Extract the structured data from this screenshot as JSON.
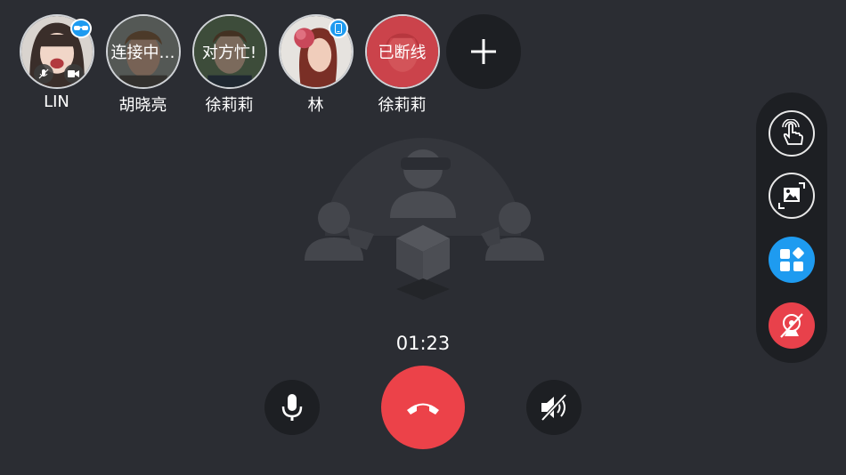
{
  "participants": [
    {
      "name": "LIN",
      "status": "",
      "badge": "glasses-icon"
    },
    {
      "name": "胡晓亮",
      "status": "连接中…",
      "badge": ""
    },
    {
      "name": "徐莉莉",
      "status": "对方忙!",
      "badge": ""
    },
    {
      "name": "林",
      "status": "",
      "badge": "phone-icon"
    },
    {
      "name": "徐莉莉",
      "status": "已断线",
      "badge": ""
    }
  ],
  "call": {
    "timer": "01:23"
  },
  "colors": {
    "background": "#2b2d33",
    "hangup": "#ec4249",
    "accent_blue": "#1e9bf0",
    "panel": "#1d1f23"
  },
  "side_tools": [
    "touch-pointer-icon",
    "screenshot-icon",
    "apps-icon",
    "camera-off-icon"
  ],
  "controls": [
    "microphone-icon",
    "hang-up-icon",
    "speaker-mute-icon"
  ]
}
